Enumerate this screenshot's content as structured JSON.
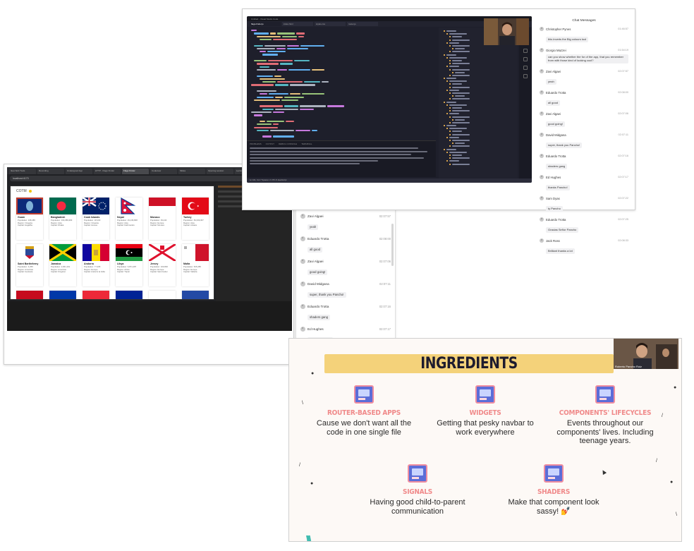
{
  "top_window": {
    "title": "Untitled - Visual Studio Code",
    "editor_tabs": [
      "flags-finder.js",
      "index.html",
      "styles.css",
      "router.js"
    ],
    "terminal_tabs": [
      "PROBLEMS",
      "OUTPUT",
      "DEBUG CONSOLE",
      "TERMINAL"
    ],
    "status": "Ln 101, Col 7   Spaces: 2   UTF-8   JavaScript"
  },
  "chat": {
    "title": "Chat Messages",
    "messages": [
      {
        "author": "Christopher Pynes",
        "time": "01:46:57",
        "text": "this inverts the Big colours tool"
      },
      {
        "author": "Giorgio Mazzei",
        "time": "01:54:19",
        "text": "can you show whether the for of the app, that you remember from with those kind of looking cool?"
      },
      {
        "author": "Zavi Algaei",
        "time": "02:07:57",
        "text": "yeah"
      },
      {
        "author": "Eduardo Trotta",
        "time": "02:08:00",
        "text": "all good"
      },
      {
        "author": "Zavi Algaei",
        "time": "02:07:06",
        "text": "good going!"
      },
      {
        "author": "David Midgana",
        "time": "02:07:11",
        "text": "super, thank you Pancho!"
      },
      {
        "author": "Eduardo Trotta",
        "time": "02:07:16",
        "text": "shaders gang"
      },
      {
        "author": "Ed Hughes",
        "time": "02:07:17",
        "text": "thanks Pancho!"
      },
      {
        "author": "Sam Dyas",
        "time": "02:07:22",
        "text": "ty Pancho"
      },
      {
        "author": "Eduardo Trotta",
        "time": "02:07:25",
        "text": "Gracias Señor Pancho"
      },
      {
        "author": "Jack Ross",
        "time": "02:08:33",
        "text": "Brilliant thanks a lot"
      }
    ],
    "continuation": [
      {
        "author": "Zavi Algaei",
        "time": "02:07:57",
        "text": "yeah"
      },
      {
        "author": "Eduardo Trotta",
        "time": "02:08:00",
        "text": "all good"
      },
      {
        "author": "Zavi Algaei",
        "time": "02:07:06",
        "text": "good going!"
      },
      {
        "author": "David Midgana",
        "time": "02:07:11",
        "text": "super, thank you Pancho!"
      },
      {
        "author": "Eduardo Trotta",
        "time": "02:07:16",
        "text": "shaders gang"
      },
      {
        "author": "Ed Hughes",
        "time": "02:07:17",
        "text": "thanks Pancho!"
      },
      {
        "author": "Sam Dyas",
        "time": "02:07:22",
        "text": "ty Pancho"
      },
      {
        "author": "Eduardo Trotta",
        "time": "02:07:25",
        "text": "Gracias Señor Pancho"
      },
      {
        "author": "Jack Ross",
        "time": "02:08:33",
        "text": "Brilliant thanks a lot"
      }
    ]
  },
  "browser": {
    "tabs": [
      "Ikea Web Tools",
      "Recording",
      "Undesigned App",
      "HTTP - Flags Finder",
      "Flags Finder",
      "Codeview",
      "Slides",
      "Opening session",
      "Lecture 16: Internl",
      "Lecture 16"
    ],
    "address": "localhost:4173",
    "page_title": "COTM",
    "flags_row1": [
      {
        "name": "Guam",
        "population": "Population: 168,485",
        "region": "Region: Oceania",
        "capital": "Capital: Hagåtña"
      },
      {
        "name": "Bangladesh",
        "population": "Population: 164,689,383",
        "region": "Region: Asia",
        "capital": "Capital: Dhaka"
      },
      {
        "name": "Cook Islands",
        "population": "Population: 18,100",
        "region": "Region: Oceania",
        "capital": "Capital: Avarua"
      },
      {
        "name": "Nepal",
        "population": "Population: 29,136,808",
        "region": "Region: Asia",
        "capital": "Capital: Kathmandu"
      },
      {
        "name": "Monaco",
        "population": "Population: 39,244",
        "region": "Region: Europe",
        "capital": "Capital: Monaco"
      },
      {
        "name": "Turkey",
        "population": "Population: 84,339,067",
        "region": "Region: Asia",
        "capital": "Capital: Ankara"
      }
    ],
    "flags_row2": [
      {
        "name": "Saint Barthélemy",
        "population": "Population: 4,255",
        "region": "Region: Americas",
        "capital": "Capital: Gustavia"
      },
      {
        "name": "Jamaica",
        "population": "Population: 2,961,161",
        "region": "Region: Americas",
        "capital": "Capital: Kingston"
      },
      {
        "name": "Andorra",
        "population": "Population: 77,265",
        "region": "Region: Europe",
        "capital": "Capital: Andorra la Vella"
      },
      {
        "name": "Libya",
        "population": "Population: 6,871,287",
        "region": "Region: Africa",
        "capital": "Capital: Tripoli"
      },
      {
        "name": "Jersey",
        "population": "Population: 100,800",
        "region": "Region: Europe",
        "capital": "Capital: Saint Helier"
      },
      {
        "name": "Malta",
        "population": "Population: 525,285",
        "region": "Region: Europe",
        "capital": "Capital: Valletta"
      }
    ]
  },
  "slide": {
    "title": "INGREDIENTS",
    "presenter": "Roberto Pancho Ruiz",
    "items": [
      {
        "head": "ROUTER-BASED APPS",
        "desc": "Cause we don't want all the code in one single file"
      },
      {
        "head": "WIDGETS",
        "desc": "Getting that pesky navbar to work everywhere"
      },
      {
        "head": "COMPONENTS' LIFECYCLES",
        "desc": "Events throughout our components' lives. Including teenage years."
      },
      {
        "head": "SIGNALS",
        "desc": "Having good child-to-parent communication"
      },
      {
        "head": "SHADERS",
        "desc": "Make that component look sassy! 💅"
      }
    ]
  },
  "colors": {
    "accent_pink": "#f08a8a",
    "title_yellow": "#f4d27a",
    "icon_blue": "#5b6dd8",
    "editor_bg": "#1e1f2b"
  }
}
